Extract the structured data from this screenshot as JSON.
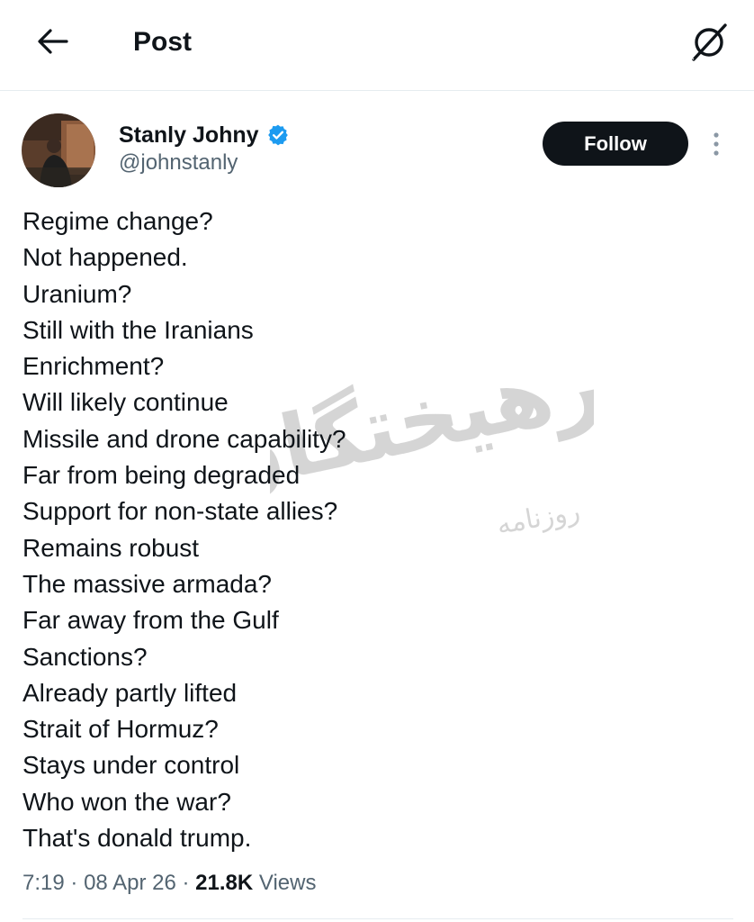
{
  "header": {
    "title": "Post",
    "back_icon": "arrow-left-icon",
    "grok_icon": "grok-icon"
  },
  "author": {
    "name": "Stanly Johny",
    "handle": "@johnstanly",
    "verified": true,
    "verified_color": "#1d9bf0",
    "follow_label": "Follow"
  },
  "tweet": {
    "lines": [
      "Regime change?",
      "Not happened.",
      "Uranium?",
      "Still with the Iranians",
      "Enrichment?",
      "Will likely continue",
      "Missile and drone capability?",
      "Far from being degraded",
      "Support for non-state allies?",
      "Remains robust",
      "The massive armada?",
      "Far away from the Gulf",
      "Sanctions?",
      "Already partly lifted",
      "Strait of Hormuz?",
      "Stays under control",
      "Who won the war?",
      "That's donald trump."
    ],
    "time": "7:19",
    "date": "08 Apr 26",
    "views_count": "21.8K",
    "views_label": "Views",
    "separator": "·"
  },
  "watermark": {
    "text": "فرهیختگان",
    "subtext": "روزنامه"
  },
  "colors": {
    "text_primary": "#0f1419",
    "text_secondary": "#536471",
    "divider": "#e6ecf0"
  }
}
